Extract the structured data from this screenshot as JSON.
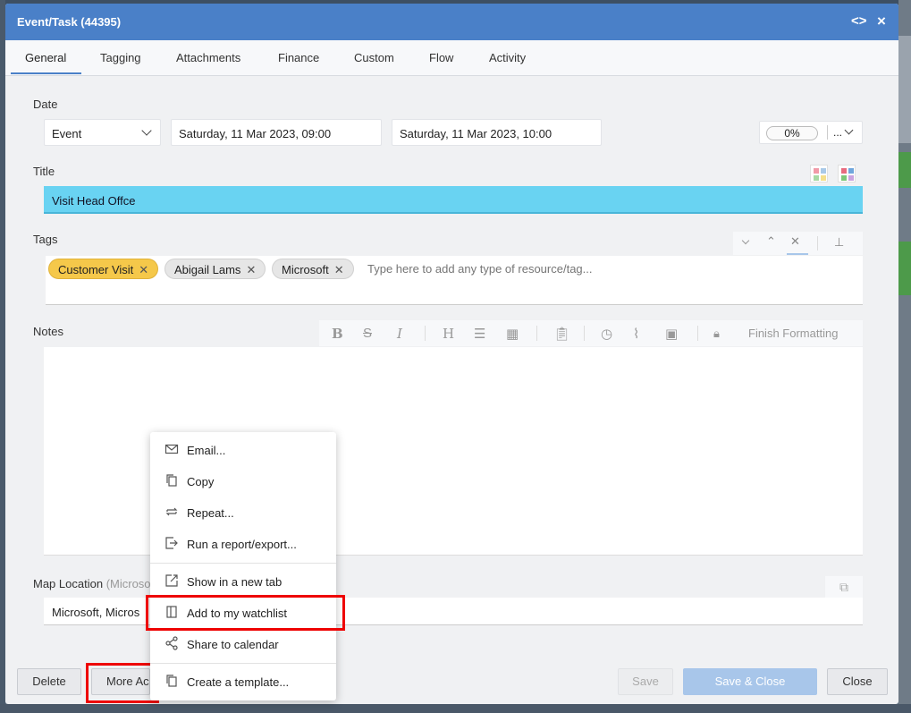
{
  "modal": {
    "title": "Event/Task (44395)",
    "code_icon": "<>",
    "close_icon": "×"
  },
  "tabs": [
    "General",
    "Tagging",
    "Attachments",
    "Finance",
    "Custom",
    "Flow",
    "Activity"
  ],
  "date": {
    "label": "Date",
    "type_value": "Event",
    "start": "Saturday, 11 Mar 2023, 09:00",
    "end": "Saturday, 11 Mar 2023, 10:00",
    "progress": "0%",
    "more": "..."
  },
  "title_section": {
    "label": "Title",
    "value": "Visit Head Offce",
    "highlight_color": "#69d3f2"
  },
  "tags_section": {
    "label": "Tags",
    "tags": [
      {
        "label": "Customer Visit",
        "color": "#f5c84a"
      },
      {
        "label": "Abigail Lams",
        "color": "#e6e6e6"
      },
      {
        "label": "Microsoft",
        "color": "#e6e6e6"
      }
    ],
    "placeholder": "Type here to add any type of resource/tag..."
  },
  "notes_section": {
    "label": "Notes",
    "finish_formatting": "Finish Formatting"
  },
  "map_section": {
    "label": "Map Location",
    "label_hint": "(Microso",
    "value": "Microsoft, Micros"
  },
  "footer": {
    "delete": "Delete",
    "more_actions": "More Ac",
    "save": "Save",
    "save_close": "Save & Close",
    "close": "Close"
  },
  "menu": {
    "items": [
      {
        "label": "Email...",
        "icon": "envelope-icon"
      },
      {
        "label": "Copy",
        "icon": "copy-icon"
      },
      {
        "label": "Repeat...",
        "icon": "repeat-icon"
      },
      {
        "label": "Run a report/export...",
        "icon": "export-icon"
      },
      {
        "label": "Show in a new tab",
        "icon": "new-tab-icon"
      },
      {
        "label": "Add to my watchlist",
        "icon": "watchlist-icon"
      },
      {
        "label": "Share to calendar",
        "icon": "share-icon"
      },
      {
        "label": "Create a template...",
        "icon": "template-icon"
      }
    ]
  }
}
